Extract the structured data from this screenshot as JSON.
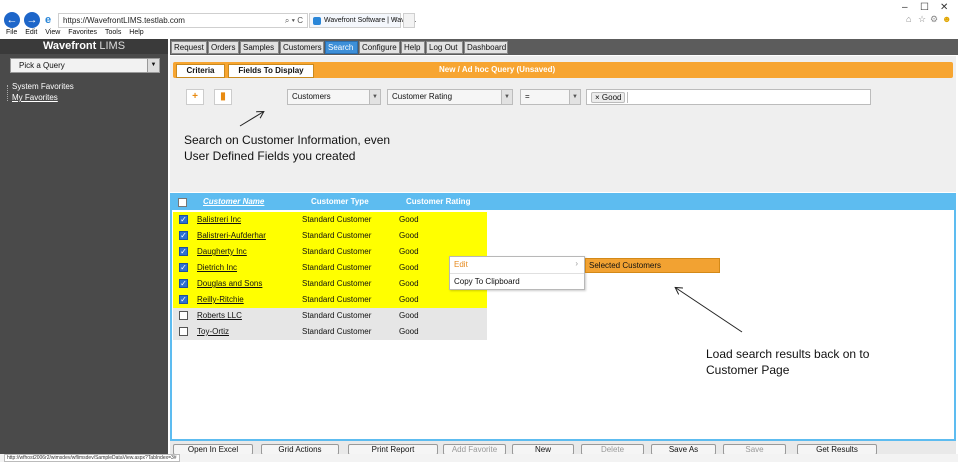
{
  "browser": {
    "url": "https://WavefrontLIMS.testlab.com",
    "address_tools": "⌕ ▾ C",
    "tab_title": "Wavefront Software | Wavef...",
    "tab_close": "×",
    "menu": [
      "File",
      "Edit",
      "View",
      "Favorites",
      "Tools",
      "Help"
    ],
    "status_url": "http://wfhost2006r2/wimsdev/wflimsdev/SampleDataView.aspx?TabIndex=3#"
  },
  "sidebar": {
    "brand_main": "Wavefront",
    "brand_sub": "LIMS",
    "query_select": "Pick a Query",
    "system_favorites": "System Favorites",
    "my_favorites": "My Favorites"
  },
  "nav": {
    "items": [
      "Request",
      "Orders",
      "Samples",
      "Customers",
      "Search",
      "Configure",
      "Help",
      "Log Out",
      "Dashboard"
    ],
    "active": "Search"
  },
  "criteria": {
    "tab_criteria": "Criteria",
    "tab_fields": "Fields To Display",
    "title": "New / Ad hoc Query (Unsaved)",
    "add_label": "+",
    "delete_icon": "trash-icon",
    "entity_select": "Customers",
    "field_select": "Customer Rating",
    "operator_select": "=",
    "value_chip": "Good"
  },
  "annotations": {
    "search_line1": "Search on Customer Information, even",
    "search_line2": "User Defined Fields you created",
    "load_line1": "Load search results back on to",
    "load_line2": "Customer Page"
  },
  "table": {
    "headers": [
      "Customer Name",
      "Customer Type",
      "Customer Rating"
    ],
    "rows": [
      {
        "name": "Balistreri Inc",
        "type": "Standard Customer",
        "rating": "Good",
        "checked": true
      },
      {
        "name": "Balistreri-Aufderhar",
        "type": "Standard Customer",
        "rating": "Good",
        "checked": true
      },
      {
        "name": "Daugherty Inc",
        "type": "Standard Customer",
        "rating": "Good",
        "checked": true
      },
      {
        "name": "Dietrich Inc",
        "type": "Standard Customer",
        "rating": "Good",
        "checked": true
      },
      {
        "name": "Douglas and Sons",
        "type": "Standard Customer",
        "rating": "Good",
        "checked": true
      },
      {
        "name": "Reilly-Ritchie",
        "type": "Standard Customer",
        "rating": "Good",
        "checked": true
      },
      {
        "name": "Roberts LLC",
        "type": "Standard Customer",
        "rating": "Good",
        "checked": false
      },
      {
        "name": "Toy-Ortiz",
        "type": "Standard Customer",
        "rating": "Good",
        "checked": false
      }
    ]
  },
  "context_menu": {
    "edit": "Edit",
    "copy": "Copy To Clipboard",
    "submenu_selected": "Selected Customers"
  },
  "toolbar": {
    "open_excel": "Open In Excel",
    "grid_actions": "Grid Actions",
    "print_report": "Print Report",
    "add_favorite": "Add Favorite",
    "new": "New",
    "delete": "Delete",
    "save_as": "Save As",
    "save": "Save",
    "get_results": "Get Results"
  },
  "colors": {
    "accent_orange": "#f7a531",
    "header_blue": "#5dbcf0",
    "selected_row": "#ffff00",
    "active_tab": "#3d8fd8"
  }
}
